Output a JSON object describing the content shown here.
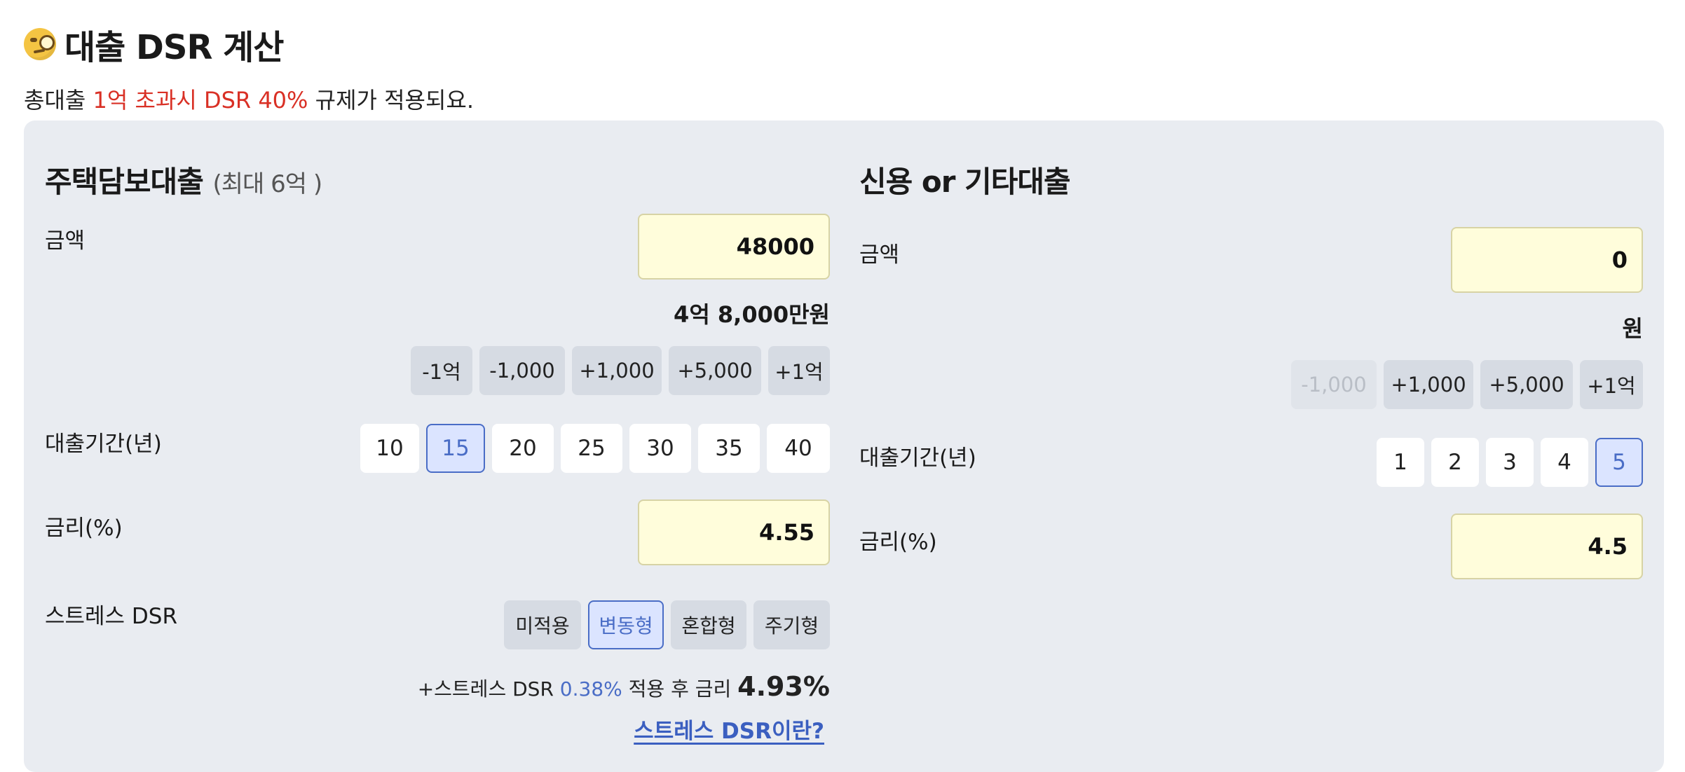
{
  "header": {
    "emoji": "monocle-face",
    "title": "대출 DSR 계산",
    "subtitle_prefix": "총대출 ",
    "subtitle_highlight": "1억 초과시 DSR 40%",
    "subtitle_suffix": " 규제가 적용되요."
  },
  "mortgage": {
    "title": "주택담보대출",
    "title_note": "(최대 6억 )",
    "amount_label": "금액",
    "amount_value": "48000",
    "amount_text": "4억 8,000만원",
    "adjust_buttons": [
      "-1억",
      "-1,000",
      "+1,000",
      "+5,000",
      "+1억"
    ],
    "term_label": "대출기간(년)",
    "terms": [
      "10",
      "15",
      "20",
      "25",
      "30",
      "35",
      "40"
    ],
    "selected_term": "15",
    "rate_label": "금리(%)",
    "rate_value": "4.55",
    "stress_label": "스트레스 DSR",
    "stress_options": [
      "미적용",
      "변동형",
      "혼합형",
      "주기형"
    ],
    "selected_stress": "변동형",
    "stress_prefix": "+스트레스 DSR ",
    "stress_rate": "0.38%",
    "stress_mid": " 적용 후 금리 ",
    "final_rate": "4.93%",
    "stress_link": "스트레스 DSR이란?"
  },
  "credit": {
    "title": "신용 or 기타대출",
    "amount_label": "금액",
    "amount_value": "0",
    "amount_text": "원",
    "adjust_buttons": [
      "-1,000",
      "+1,000",
      "+5,000",
      "+1억"
    ],
    "term_label": "대출기간(년)",
    "terms": [
      "1",
      "2",
      "3",
      "4",
      "5"
    ],
    "selected_term": "5",
    "rate_label": "금리(%)",
    "rate_value": "4.5"
  },
  "colors": {
    "accent_red": "#d93025",
    "accent_blue": "#4a6dc6",
    "panel_bg": "#e9ecf1",
    "input_bg": "#fffddb"
  }
}
